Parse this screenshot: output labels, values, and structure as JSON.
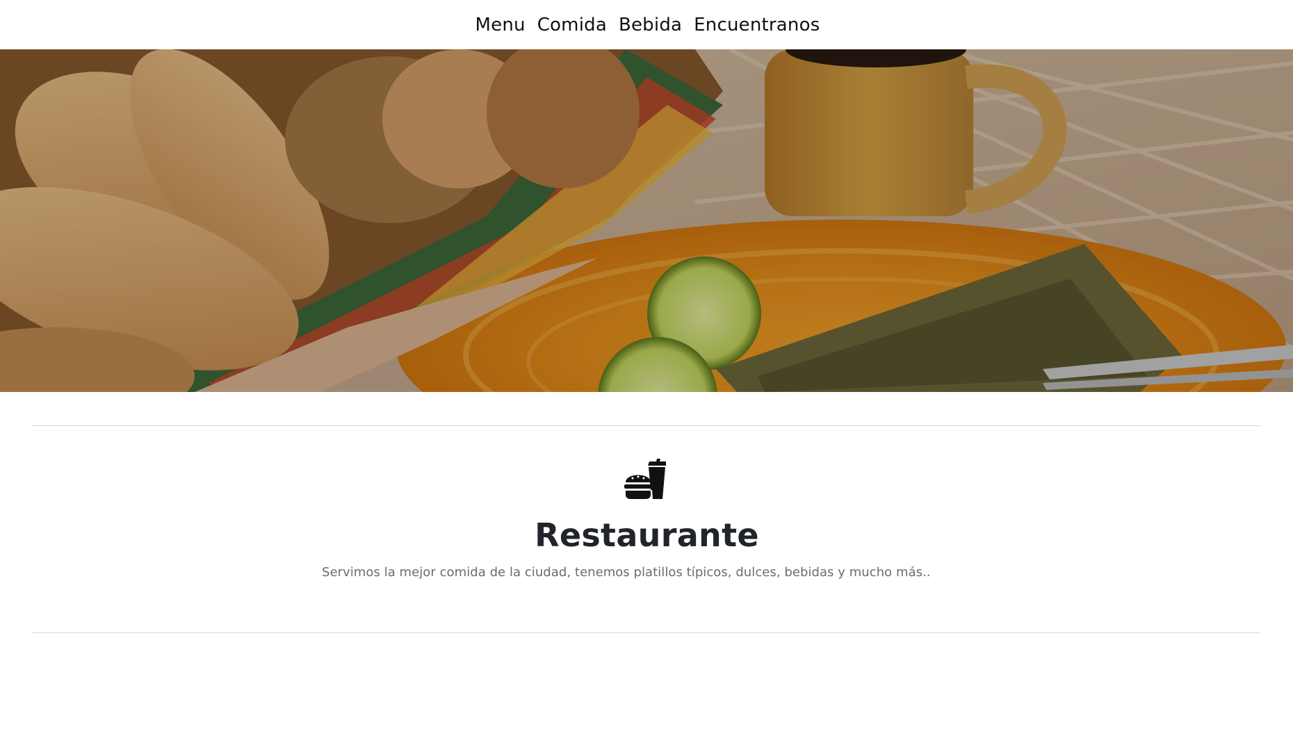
{
  "nav": {
    "items": [
      {
        "label": "Menu"
      },
      {
        "label": "Comida"
      },
      {
        "label": "Bebida"
      },
      {
        "label": "Encuentranos"
      }
    ]
  },
  "hero": {
    "image": "bread-limes-tamales-coffee-photo"
  },
  "feature": {
    "icon": "hamburger-soda-icon",
    "title": "Restaurante",
    "description": "Servimos la mejor comida de la ciudad, tenemos platillos típicos, dulces, bebidas y mucho más.."
  },
  "colors": {
    "text": "#212529",
    "muted": "#6c6c6c",
    "divider": "#d6d6d6",
    "background": "#ffffff"
  }
}
